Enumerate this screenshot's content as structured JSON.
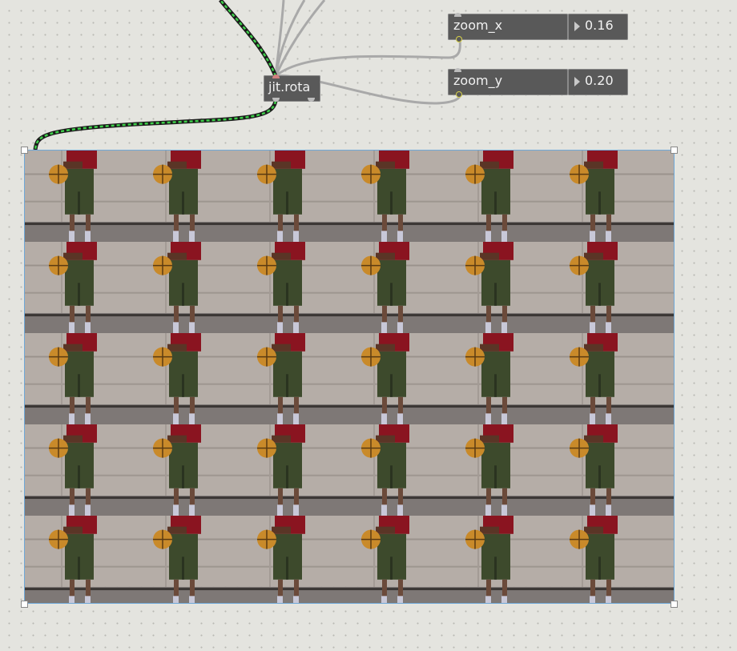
{
  "patcher": {
    "objects": [
      {
        "id": "zoom_x",
        "label": "zoom_x"
      },
      {
        "id": "zoom_y",
        "label": "zoom_y"
      },
      {
        "id": "jit_rota",
        "label": "jit.rota"
      }
    ],
    "number_boxes": [
      {
        "id": "zoom_x_value",
        "value": "0.16"
      },
      {
        "id": "zoom_y_value",
        "value": "0.20"
      }
    ],
    "video_display": {
      "content": "tiled video of person holding basketball",
      "tile_columns": 6,
      "tile_rows": 5
    }
  },
  "colors": {
    "canvas": "#e4e4df",
    "object_box": "#595959",
    "object_text": "#f0f0f0",
    "patch_cord": "#a9a9a9",
    "signal_cord": "#2a9a3a",
    "selection_border": "#6fa8d8"
  }
}
